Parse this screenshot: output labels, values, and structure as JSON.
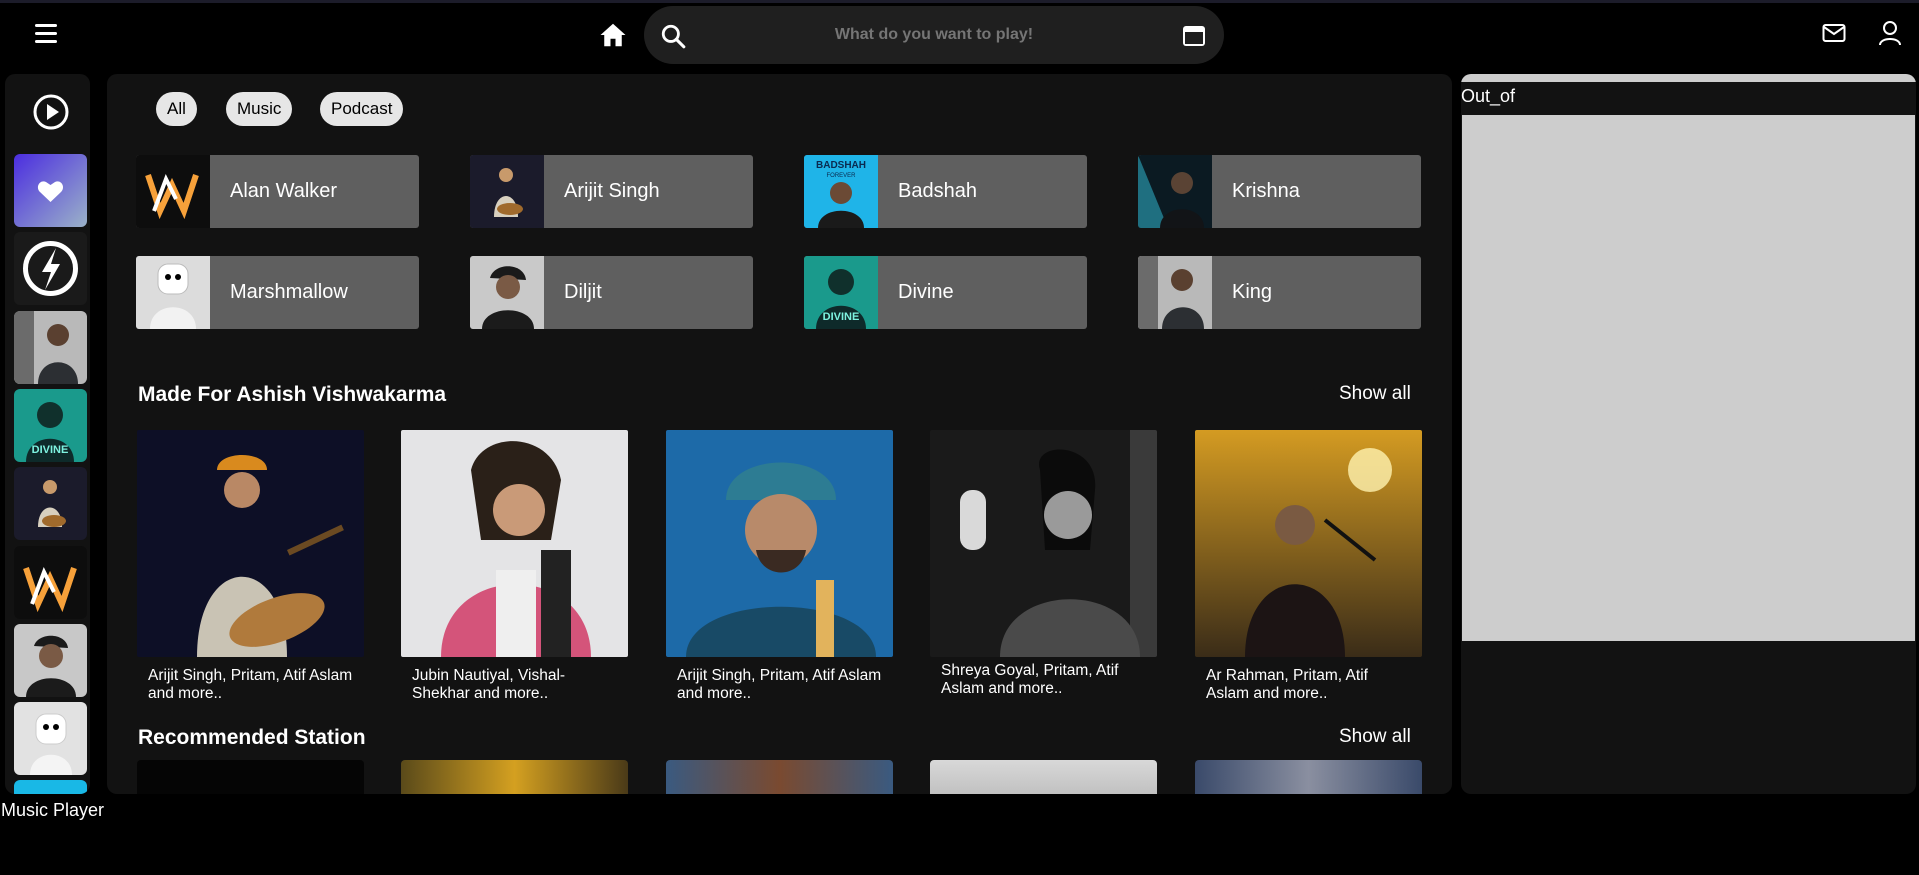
{
  "search": {
    "placeholder": "What do you want to play!"
  },
  "filters": [
    "All",
    "Music",
    "Podcast"
  ],
  "artists": [
    {
      "name": "Alan Walker"
    },
    {
      "name": "Arijit Singh"
    },
    {
      "name": "Badshah"
    },
    {
      "name": "Krishna"
    },
    {
      "name": "Marshmallow"
    },
    {
      "name": "Diljit"
    },
    {
      "name": "Divine"
    },
    {
      "name": "King"
    }
  ],
  "made_for": {
    "title": "Made For Ashish Vishwakarma",
    "show_all": "Show all",
    "items": [
      {
        "caption": "Arijit Singh, Pritam, Atif Aslam and more.."
      },
      {
        "caption": "Jubin Nautiyal, Vishal-Shekhar and more.."
      },
      {
        "caption": "Arijit Singh, Pritam, Atif Aslam and more.."
      },
      {
        "caption": "Shreya Goyal, Pritam, Atif Aslam and more.."
      },
      {
        "caption": "Ar Rahman, Pritam, Atif Aslam and more.."
      }
    ]
  },
  "recommended": {
    "title": "Recommended Station",
    "show_all": "Show all"
  },
  "right_panel": {
    "label": "Out_of"
  },
  "player": {
    "label": "Music Player"
  },
  "thumb_text": {
    "badshah_top": "BADSHAH",
    "badshah_sub": "FOREVER",
    "divine": "DIVINE"
  }
}
